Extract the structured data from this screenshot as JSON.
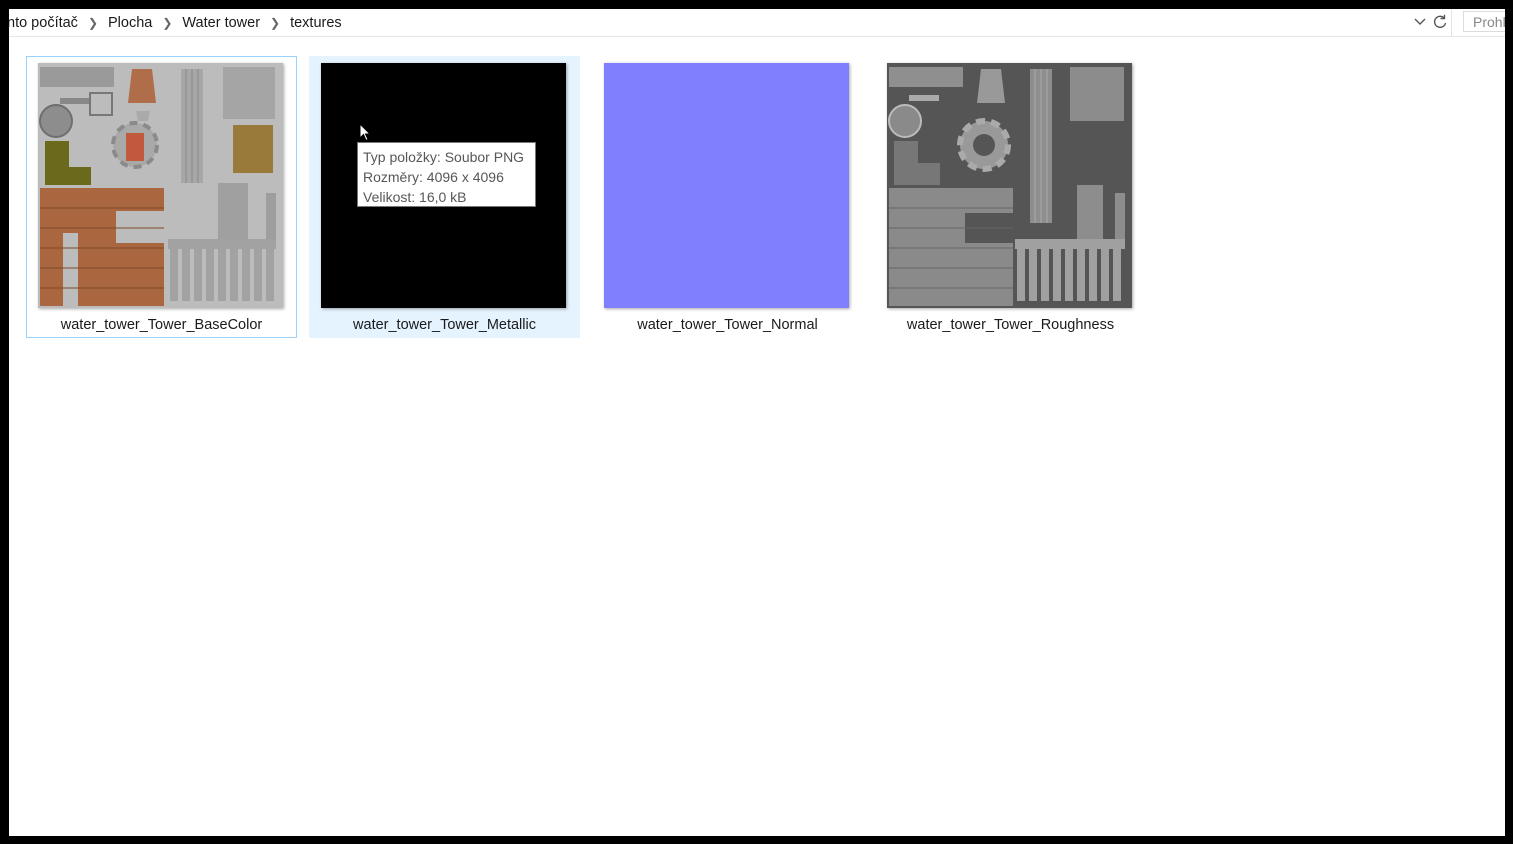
{
  "breadcrumb": {
    "items": [
      "nto počítač",
      "Plocha",
      "Water tower",
      "textures"
    ]
  },
  "address_controls": {
    "dropdown_icon": "chevron-down-icon",
    "refresh_icon": "refresh-icon"
  },
  "search": {
    "placeholder": "Prohl"
  },
  "files": [
    {
      "name": "water_tower_Tower_BaseColor",
      "state": "focused"
    },
    {
      "name": "water_tower_Tower_Metallic",
      "state": "hovered"
    },
    {
      "name": "water_tower_Tower_Normal",
      "state": "normal"
    },
    {
      "name": "water_tower_Tower_Roughness",
      "state": "normal"
    }
  ],
  "tooltip": {
    "type": "Typ položky: Soubor PNG",
    "dimensions": "Rozměry: 4096 x 4096",
    "size": "Velikost: 16,0 kB"
  },
  "colors": {
    "selection_border": "#99d1ff",
    "hover_background": "#e5f3ff",
    "metallic_map": "#000000",
    "normal_map": "#8080ff",
    "roughness_background": "#545454",
    "basecolor_background": "#b9b9b9"
  }
}
